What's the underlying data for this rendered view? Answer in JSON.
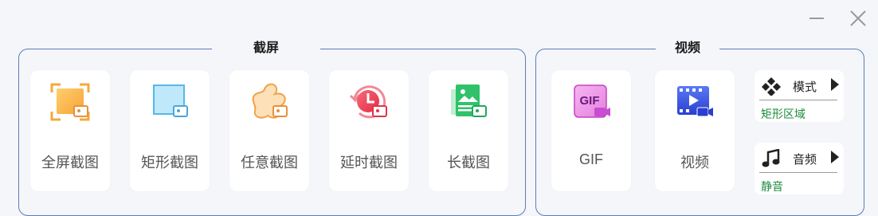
{
  "window": {
    "minimize_icon": "minimize-icon",
    "close_icon": "close-icon"
  },
  "capture": {
    "title": "截屏",
    "tools": [
      {
        "label": "全屏截图",
        "icon": "fullscreen-capture-icon"
      },
      {
        "label": "矩形截图",
        "icon": "rect-capture-icon"
      },
      {
        "label": "任意截图",
        "icon": "freeform-capture-icon"
      },
      {
        "label": "延时截图",
        "icon": "delay-capture-icon"
      },
      {
        "label": "长截图",
        "icon": "long-capture-icon"
      }
    ]
  },
  "video": {
    "title": "视频",
    "tools": [
      {
        "label": "GIF",
        "icon_text": "GIF",
        "icon": "gif-record-icon"
      },
      {
        "label": "视频",
        "icon": "video-record-icon"
      }
    ],
    "mode": {
      "label": "模式",
      "value": "矩形区域",
      "icon": "mode-diamond-icon"
    },
    "audio": {
      "label": "音频",
      "value": "静音",
      "icon": "music-note-icon"
    }
  },
  "colors": {
    "border": "#5b7cb8",
    "value_green": "#1e8a3c",
    "background": "#f5f6fa"
  }
}
